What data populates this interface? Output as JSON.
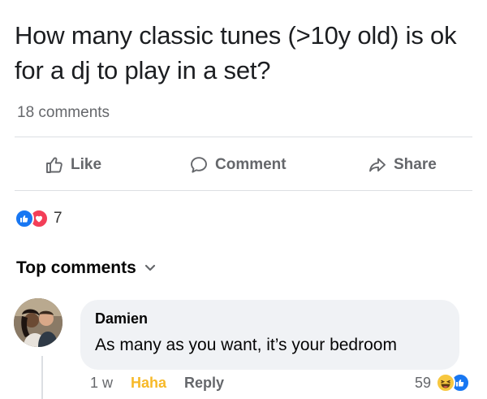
{
  "post": {
    "text": "How many classic tunes (>10y old) is ok for a dj to play in a set?",
    "comment_count": "18 comments"
  },
  "actions": {
    "like_label": "Like",
    "comment_label": "Comment",
    "share_label": "Share"
  },
  "reactions": {
    "types": [
      "like-icon",
      "love-icon"
    ],
    "count": "7"
  },
  "comments_section": {
    "sort_label": "Top comments"
  },
  "comment": {
    "author": "Damien",
    "text": "As many as you want, it’s your bedroom",
    "time": "1 w",
    "reaction_label": "Haha",
    "reply_label": "Reply",
    "reaction_count": "59",
    "reaction_types": [
      "haha-icon",
      "like-icon"
    ]
  },
  "colors": {
    "brand_blue": "#1877f2",
    "love_red": "#f33e58",
    "haha_yellow": "#f7b928",
    "secondary_text": "#65676b",
    "bubble_bg": "#f0f2f5"
  }
}
